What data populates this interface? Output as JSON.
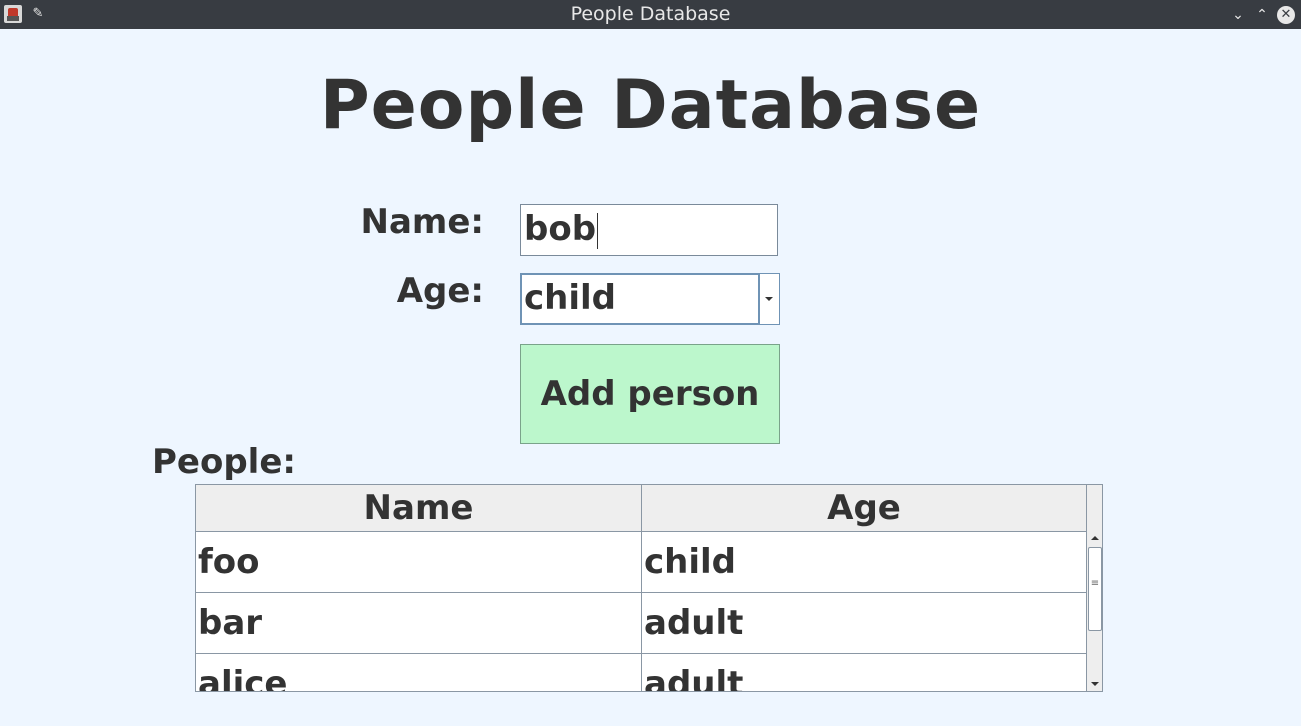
{
  "window": {
    "title": "People Database",
    "app_icon": "java-app-icon",
    "pin_icon": "pin-icon",
    "controls": [
      "minimize-icon",
      "maximize-icon",
      "close-icon"
    ]
  },
  "heading": "People Database",
  "form": {
    "name_label": "Name:",
    "name_value": "bob",
    "age_label": "Age:",
    "age_selected": "child",
    "add_button_label": "Add person"
  },
  "people": {
    "label": "People:",
    "columns": [
      "Name",
      "Age"
    ],
    "rows": [
      {
        "name": "foo",
        "age": "child"
      },
      {
        "name": "bar",
        "age": "adult"
      },
      {
        "name": "alice",
        "age": "adult"
      }
    ]
  },
  "colors": {
    "background": "#eef6ff",
    "titlebar": "#383c42",
    "button": "#bcf7cc",
    "text": "#333333"
  }
}
